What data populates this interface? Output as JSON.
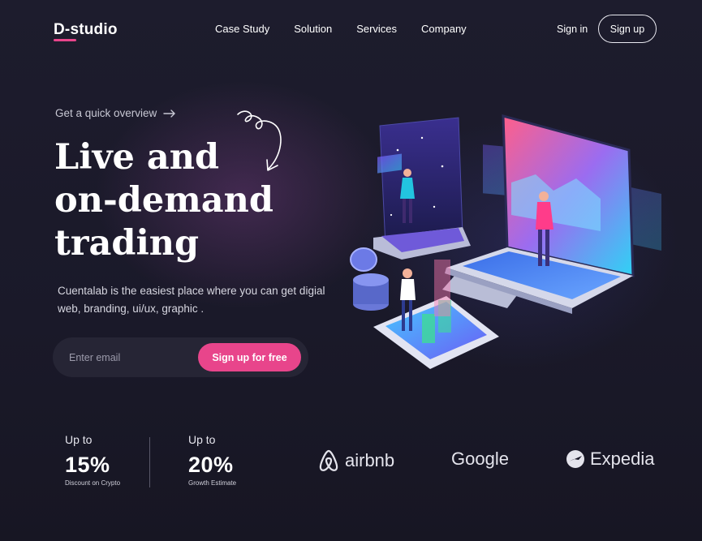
{
  "header": {
    "logo": "D-studio",
    "nav": [
      "Case Study",
      "Solution",
      "Services",
      "Company"
    ],
    "signin_label": "Sign in",
    "signup_label": "Sign up"
  },
  "hero": {
    "overview_link": "Get a quick overview",
    "headline_lines": [
      "Live and",
      "on-demand",
      "trading"
    ],
    "subtitle": "Cuentalab is the easiest place where you can get digial web, branding, ui/ux, graphic .",
    "email_placeholder": "Enter email",
    "cta_label": "Sign up for free"
  },
  "stats": [
    {
      "prefix": "Up to",
      "value": "15%",
      "caption": "Discount on Crypto"
    },
    {
      "prefix": "Up to",
      "value": "20%",
      "caption": "Growth Estimate"
    }
  ],
  "brands": [
    {
      "name": "airbnb",
      "icon": "airbnb-logo-icon"
    },
    {
      "name": "Google",
      "icon": ""
    },
    {
      "name": "Expedia",
      "icon": "expedia-globe-icon"
    }
  ],
  "colors": {
    "background": "#191827",
    "accent": "#e8458b",
    "input_bg": "#262535"
  }
}
